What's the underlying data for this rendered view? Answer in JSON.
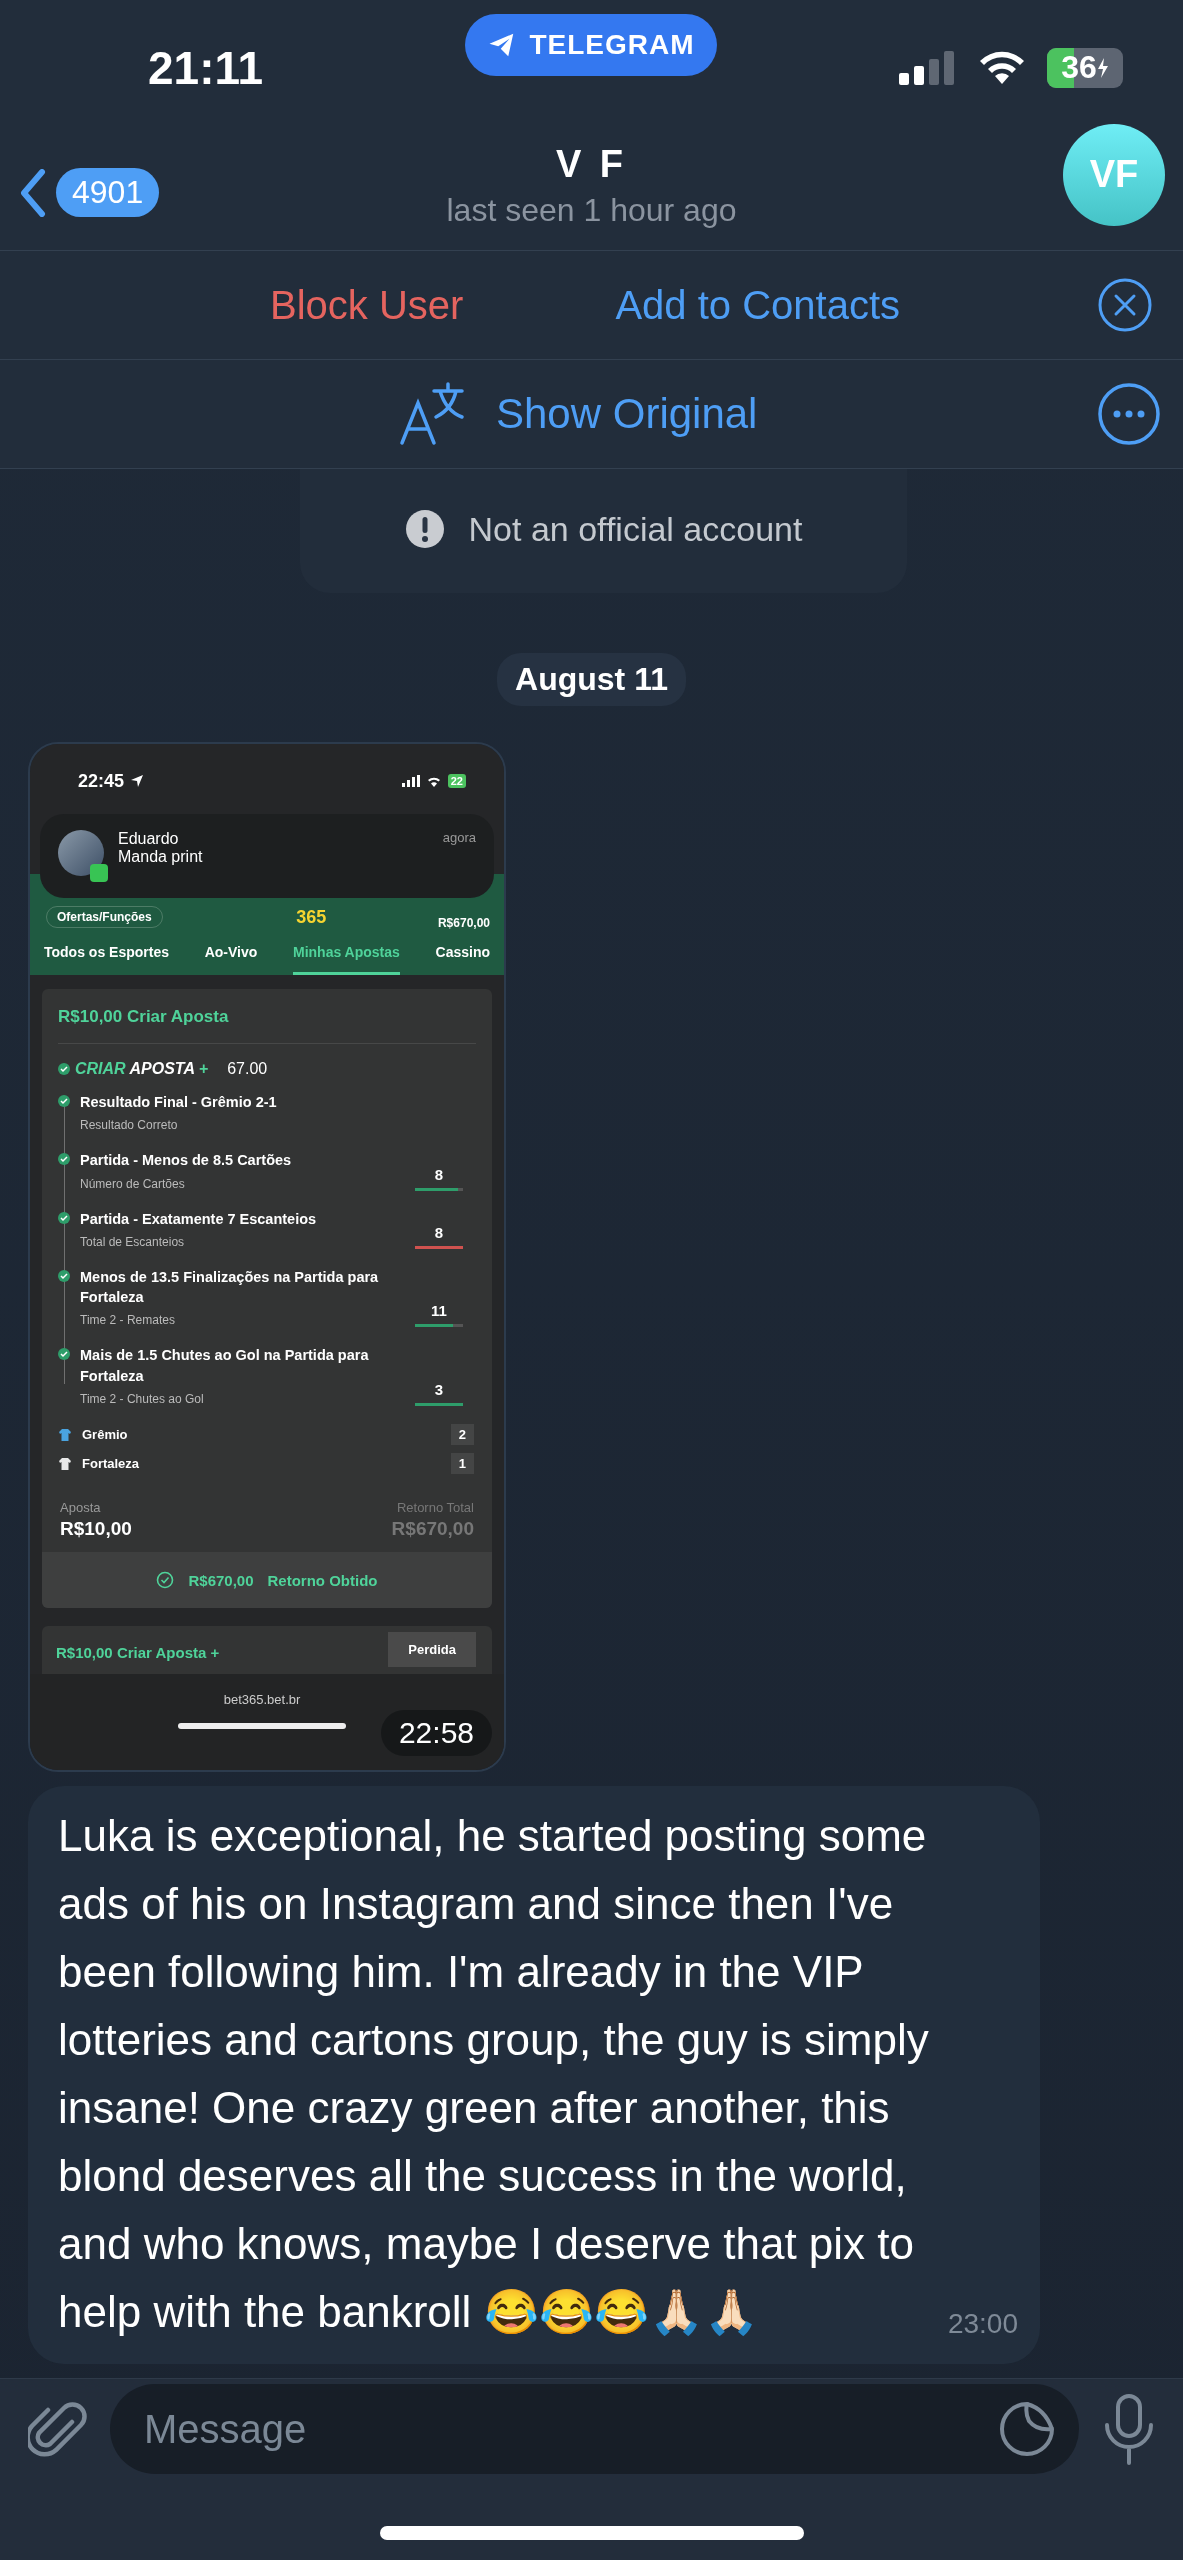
{
  "status_bar": {
    "time": "21:11",
    "app_pill": "TELEGRAM",
    "battery": "36"
  },
  "header": {
    "back_count": "4901",
    "title": "V F",
    "subtitle": "last seen 1 hour ago",
    "avatar_initials": "VF"
  },
  "action_bar": {
    "block": "Block User",
    "add": "Add to Contacts"
  },
  "translate_bar": {
    "label": "Show Original"
  },
  "info_card": {
    "notice": "Not an official account"
  },
  "date_separator": "August 11",
  "messages": [
    {
      "kind": "screenshot",
      "time": "22:58",
      "screenshot": {
        "status": {
          "time": "22:45",
          "battery": "22"
        },
        "notification": {
          "sender": "Eduardo",
          "text": "Manda print",
          "time": "agora"
        },
        "app_header": {
          "offers": "Ofertas/Funções",
          "logo": "365",
          "balance": "R$670,00"
        },
        "tabs": [
          {
            "label": "Todos os Esportes",
            "selected": false
          },
          {
            "label": "Ao-Vivo",
            "selected": false
          },
          {
            "label": "Minhas Apostas",
            "selected": true
          },
          {
            "label": "Cassino",
            "selected": false
          }
        ],
        "bet_card": {
          "title": "R$10,00 Criar Aposta",
          "badge_green": "CRIAR",
          "badge_white": "APOSTA",
          "badge_plus": "+",
          "odds": "67.00",
          "selections": [
            {
              "title": "Resultado Final - Grêmio 2-1",
              "subtitle": "Resultado Correto"
            },
            {
              "title": "Partida - Menos de 8.5 Cartões",
              "subtitle": "Número de Cartões",
              "stat": "8",
              "level": 0.9,
              "color": "#2e9d6a"
            },
            {
              "title": "Partida - Exatamente 7 Escanteios",
              "subtitle": "Total de Escanteios",
              "stat": "8",
              "level": 1,
              "color": "#d0524f"
            },
            {
              "title": "Menos de 13.5 Finalizações na Partida para Fortaleza",
              "subtitle": "Time 2 - Remates",
              "stat": "11",
              "level": 0.8,
              "color": "#2e9d6a"
            },
            {
              "title": "Mais de 1.5 Chutes ao Gol na Partida para Fortaleza",
              "subtitle": "Time 2 - Chutes ao Gol",
              "stat": "3",
              "level": 1,
              "color": "#2e9d6a"
            }
          ],
          "teams": [
            {
              "name": "Grêmio",
              "score": "2",
              "color": "#4aa3df"
            },
            {
              "name": "Fortaleza",
              "score": "1",
              "color": "#e8e8e8"
            }
          ],
          "stake_label": "Aposta",
          "stake": "R$10,00",
          "return_label": "Retorno Total",
          "return": "R$670,00",
          "banner_amount": "R$670,00",
          "banner_label": "Retorno Obtido"
        },
        "next_card": {
          "title": "R$10,00 Criar Aposta +",
          "status": "Perdida"
        },
        "url": "bet365.bet.br"
      }
    },
    {
      "kind": "text",
      "text": "Luka is exceptional, he started posting some ads of his on Instagram and since then I've been following him. I'm already in the VIP lotteries and cartons group, the guy is simply insane! One crazy green after another, this blond deserves all the success in the world, and who knows, maybe I deserve that pix to help with the bankroll 😂😂😂🙏🏻🙏🏻",
      "time": "23:00"
    }
  ],
  "composer": {
    "placeholder": "Message"
  }
}
